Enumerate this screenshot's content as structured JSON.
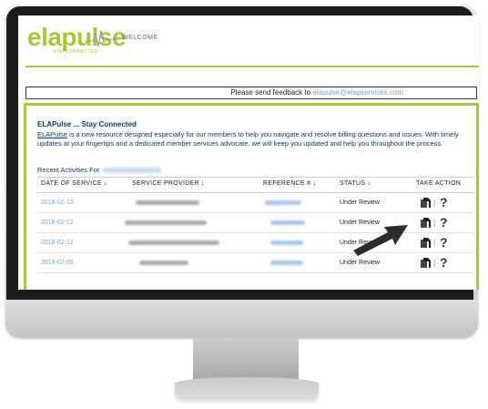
{
  "header": {
    "logo_text": "elapulse",
    "logo_tagline": "STAY CONNECTED",
    "welcome_text": "WELCOME"
  },
  "feedback": {
    "text": "Please send feedback to ",
    "email": "elapulse@elapservices.com"
  },
  "intro": {
    "title": "ELAPulse ... Stay Connected",
    "link_word": "ELAPulse",
    "body": " is a new resource designed especially for our members to help you navigate and resolve billing questions and issues. With timely updates at your fingertips and a dedicated member services advocate, we will keep you updated and help you throughout the process."
  },
  "recent": {
    "heading": "Recent Activities For"
  },
  "table": {
    "headers": {
      "date": "DATE OF SERVICE ↓",
      "provider": "SERVICE PROVIDER ↓",
      "reference": "REFERENCE # ↓",
      "status": "STATUS ↓",
      "action": "TAKE ACTION"
    },
    "rows": [
      {
        "date": "2018-02-13",
        "status": "Under Review"
      },
      {
        "date": "2018-02-12",
        "status": "Under Review"
      },
      {
        "date": "2018-02-12",
        "status": "Under Review"
      },
      {
        "date": "2018-02-09",
        "status": "Under Review"
      }
    ],
    "action_separator": "|",
    "help_glyph": "?"
  },
  "icons": {
    "document": "document-icon",
    "help": "question-mark-icon",
    "pointer": "arrow-pointer-icon"
  },
  "colors": {
    "brand_green": "#a8c73a",
    "heading_navy": "#0d3b66",
    "link_blue": "#7aa6d6"
  }
}
